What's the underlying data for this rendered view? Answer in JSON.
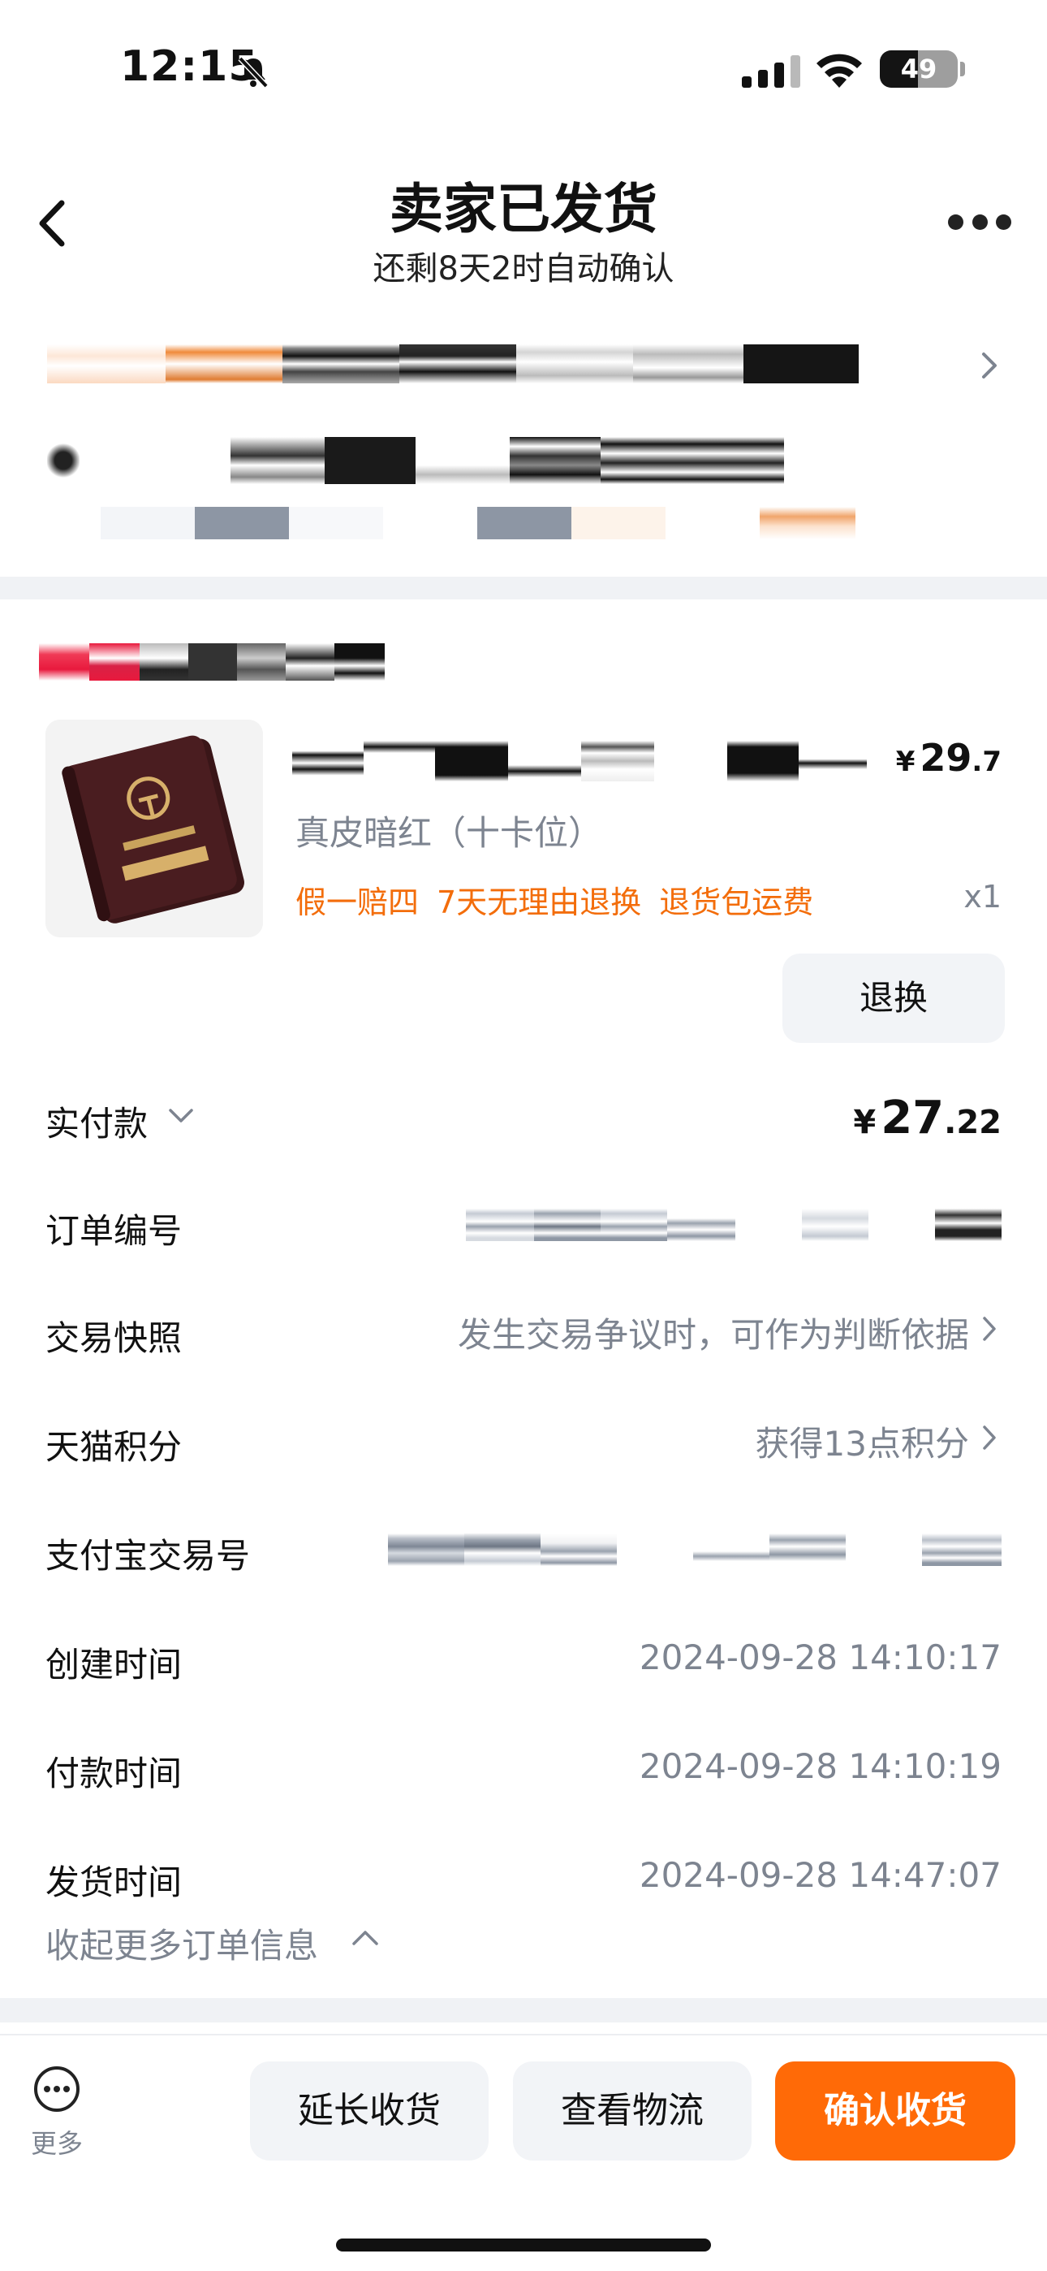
{
  "status_bar": {
    "time": "12:15",
    "battery_level": "49",
    "icons": [
      "bell-muted-icon",
      "cellular-signal-icon",
      "wifi-icon",
      "battery-icon"
    ]
  },
  "header": {
    "title": "卖家已发货",
    "subtitle": "还剩8天2时自动确认",
    "icons": [
      "chevron-left-icon",
      "more-horizontal-icon"
    ]
  },
  "product": {
    "variant": "真皮暗红（十卡位）",
    "tags": [
      "假一赔四",
      "7天无理由退换",
      "退货包运费"
    ],
    "price_currency": "¥",
    "price_int": "29",
    "price_dec": ".7",
    "quantity": "x1",
    "refund_button": "退换"
  },
  "order_info": {
    "paid": {
      "label": "实付款",
      "currency": "¥",
      "amount_int": "27",
      "amount_dec": ".22"
    },
    "order_number": {
      "label": "订单编号"
    },
    "snapshot": {
      "label": "交易快照",
      "value": "发生交易争议时，可作为判断依据"
    },
    "points": {
      "label": "天猫积分",
      "value": "获得13点积分"
    },
    "alipay": {
      "label": "支付宝交易号"
    },
    "created": {
      "label": "创建时间",
      "value": "2024-09-28 14:10:17"
    },
    "paid_time": {
      "label": "付款时间",
      "value": "2024-09-28 14:10:19"
    },
    "shipped": {
      "label": "发货时间",
      "value": "2024-09-28 14:47:07"
    },
    "collapse_label": "收起更多订单信息"
  },
  "bottom_bar": {
    "more_label": "更多",
    "extend_button": "延长收货",
    "logistics_button": "查看物流",
    "confirm_button": "确认收货"
  },
  "colors": {
    "accent_orange": "#ff6a07",
    "tag_orange": "#f36d0b",
    "muted_text": "#7d8490",
    "divider": "#f0f2f5"
  }
}
